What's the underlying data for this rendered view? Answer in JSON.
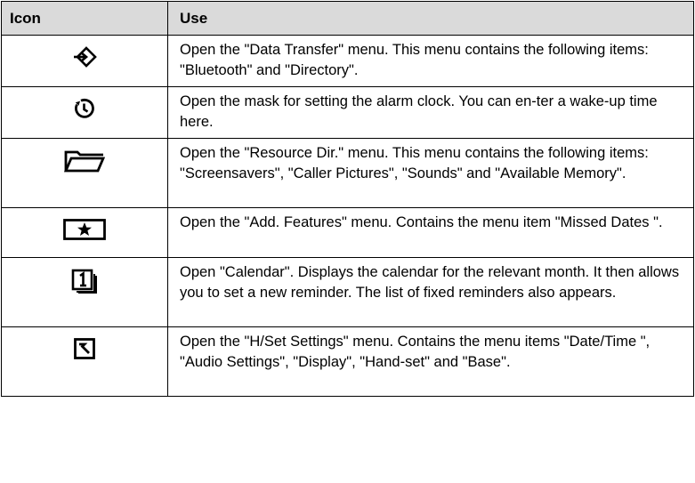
{
  "table": {
    "headers": {
      "icon": "Icon",
      "use": "Use"
    },
    "rows": [
      {
        "icon": "data-transfer-icon",
        "text": "Open the \"Data Transfer\" menu. This menu contains the following items: \"Bluetooth\" and \"Directory\"."
      },
      {
        "icon": "alarm-clock-icon",
        "text": "Open the mask for setting the alarm clock. You can en-ter a wake-up time here."
      },
      {
        "icon": "folder-icon",
        "text": "Open the \"Resource Dir.\" menu. This menu contains the following items: \"Screensavers\", \"Caller Pictures\", \"Sounds\" and \"Available Memory\"."
      },
      {
        "icon": "star-box-icon",
        "text": "Open the \"Add. Features\" menu. Contains the menu item \"Missed Dates \"."
      },
      {
        "icon": "calendar-icon",
        "text": "Open \"Calendar\". Displays the calendar for the relevant month. It then allows you to set a new reminder. The list of fixed reminders also appears."
      },
      {
        "icon": "settings-wrench-icon",
        "text": "Open the \"H/Set Settings\" menu. Contains the menu items \"Date/Time \", \"Audio Settings\", \"Display\", \"Hand-set\" and \"Base\"."
      }
    ]
  }
}
